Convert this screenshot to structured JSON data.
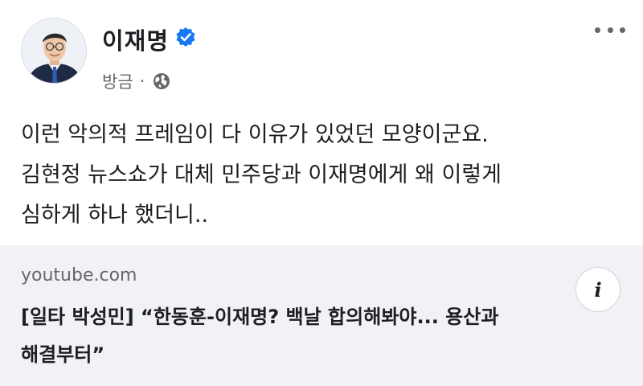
{
  "author": {
    "name": "이재명",
    "verified": true,
    "timestamp": "방금",
    "separator": "·",
    "audience_icon": "globe-icon"
  },
  "post": {
    "lines": [
      "이런 악의적 프레임이 다 이유가 있었던 모양이군요.",
      "김현정 뉴스쇼가 대체 민주당과 이재명에게 왜 이렇게",
      "심하게 하나 했더니.."
    ]
  },
  "link": {
    "domain": "youtube.com",
    "title_lines": [
      "[일타 박성민] “한동훈-이재명? 백날 합의해봐야... 용산과",
      "해결부터”"
    ],
    "info_icon": "info-icon",
    "info_glyph": "i"
  },
  "colors": {
    "verified_blue": "#1877f2",
    "secondary_text": "#65676b",
    "card_bg": "#f0f2f5"
  }
}
